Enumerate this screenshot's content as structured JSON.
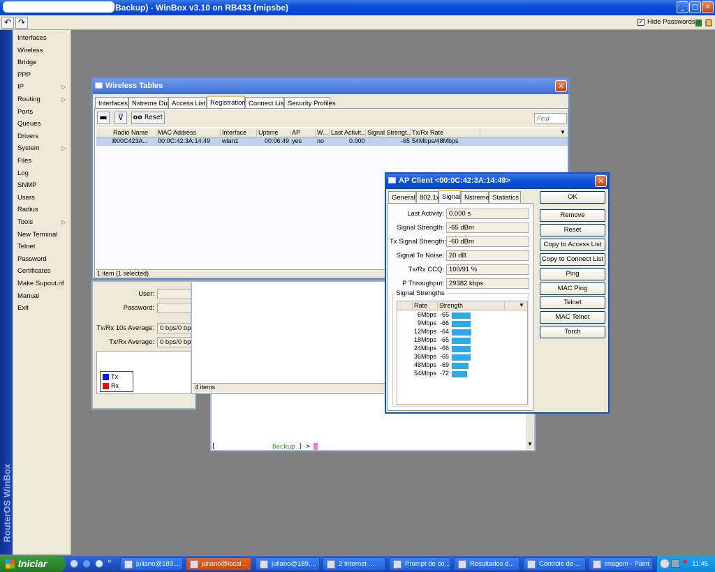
{
  "app": {
    "title": "Backup) - WinBox v3.10 on RB433 (mipsbe)",
    "hide_passwords_label": "Hide Passwords",
    "brand_vertical": "RouterOS WinBox"
  },
  "menu": {
    "items": [
      {
        "label": "Interfaces",
        "arrow": false
      },
      {
        "label": "Wireless",
        "arrow": false
      },
      {
        "label": "Bridge",
        "arrow": false
      },
      {
        "label": "PPP",
        "arrow": false
      },
      {
        "label": "IP",
        "arrow": true
      },
      {
        "label": "Routing",
        "arrow": true
      },
      {
        "label": "Ports",
        "arrow": false
      },
      {
        "label": "Queues",
        "arrow": false
      },
      {
        "label": "Drivers",
        "arrow": false
      },
      {
        "label": "System",
        "arrow": true
      },
      {
        "label": "Files",
        "arrow": false
      },
      {
        "label": "Log",
        "arrow": false
      },
      {
        "label": "SNMP",
        "arrow": false
      },
      {
        "label": "Users",
        "arrow": false
      },
      {
        "label": "Radius",
        "arrow": false
      },
      {
        "label": "Tools",
        "arrow": true
      },
      {
        "label": "New Terminal",
        "arrow": false
      },
      {
        "label": "Telnet",
        "arrow": false
      },
      {
        "label": "Password",
        "arrow": false
      },
      {
        "label": "Certificates",
        "arrow": false
      },
      {
        "label": "Make Supout.rif",
        "arrow": false
      },
      {
        "label": "Manual",
        "arrow": false
      },
      {
        "label": "Exit",
        "arrow": false
      }
    ]
  },
  "wireless_tables": {
    "title": "Wireless Tables",
    "tabs": [
      "Interfaces",
      "Nstreme Dual",
      "Access List",
      "Registration",
      "Connect List",
      "Security Profiles"
    ],
    "selected_tab": "Registration",
    "reset_label": "Reset",
    "reset_prefix": "oo",
    "find_placeholder": "Find",
    "columns": [
      "Radio Name",
      "MAC Address",
      "Interface",
      "Uptime",
      "AP",
      "W...",
      "Last Activit...",
      "Signal Strengt...",
      "Tx/Rx Rate"
    ],
    "row": {
      "radio_name": "000C423A...",
      "mac": "00:0C:42:3A:14:49",
      "interface": "wlan1",
      "uptime": "00:06:49",
      "ap": "yes",
      "w": "no",
      "last_activity": "0.000",
      "signal": "-65",
      "rate": "54Mbps/48Mbps"
    },
    "status": "1 item (1 selected)"
  },
  "stats_window": {
    "user_label": "User:",
    "password_label": "Password:",
    "avg10_label": "Tx/Rx 10s Average:",
    "avg10_value": "0 bps/0 bps",
    "avg_label": "Tx/Rx Average:",
    "avg_value": "0 bps/0 bps",
    "legend_tx": "Tx",
    "legend_rx": "Rx",
    "tx_color": "#0022dd",
    "rx_color": "#dd1111"
  },
  "list_window": {
    "status": "4 items"
  },
  "terminal": {
    "prompt_prefix": "[",
    "prompt_host": "Backup",
    "prompt_suffix": "] >"
  },
  "ap_client": {
    "title": "AP Client <00:0C:42:3A:14:49>",
    "tabs": [
      "General",
      "802.1x",
      "Signal",
      "Nstreme",
      "Statistics"
    ],
    "selected_tab": "Signal",
    "fields": [
      {
        "label": "Last Activity:",
        "value": "0.000 s"
      },
      {
        "label": "Signal Strength:",
        "value": "-65 dBm"
      },
      {
        "label": "Tx Signal Strength:",
        "value": "-60 dBm"
      },
      {
        "label": "Signal To Noise:",
        "value": "20 dB"
      },
      {
        "label": "Tx/Rx CCQ:",
        "value": "100/91 %"
      },
      {
        "label": "P Throughput:",
        "value": "29382 kbps"
      }
    ],
    "strengths_group": "Signal Strengths",
    "strength_columns": [
      "Rate",
      "Strength"
    ],
    "strengths": [
      {
        "rate": "6Mbps",
        "strength": -65
      },
      {
        "rate": "9Mbps",
        "strength": -66
      },
      {
        "rate": "12Mbps",
        "strength": -64
      },
      {
        "rate": "18Mbps",
        "strength": -65
      },
      {
        "rate": "24Mbps",
        "strength": -66
      },
      {
        "rate": "36Mbps",
        "strength": -65
      },
      {
        "rate": "48Mbps",
        "strength": -69
      },
      {
        "rate": "54Mbps",
        "strength": -72
      }
    ],
    "bar_color": "#2fa8e8",
    "buttons": [
      "OK",
      "Remove",
      "Reset",
      "Copy to Access List",
      "Copy to Connect List",
      "Ping",
      "MAC Ping",
      "Telnet",
      "MAC Telnet",
      "Torch"
    ]
  },
  "taskbar": {
    "start_label": "Iniciar",
    "tasks": [
      {
        "label": "juliano@189....",
        "active": false
      },
      {
        "label": "juliano@local...",
        "active": true
      },
      {
        "label": "juliano@189....",
        "active": false
      },
      {
        "label": "2 Internet ...",
        "active": false
      },
      {
        "label": "Prompt de co...",
        "active": false
      },
      {
        "label": "Resultados d...",
        "active": false
      },
      {
        "label": "Controle de ...",
        "active": false
      },
      {
        "label": "imagem - Paint",
        "active": false
      }
    ],
    "clock": "11:45"
  }
}
